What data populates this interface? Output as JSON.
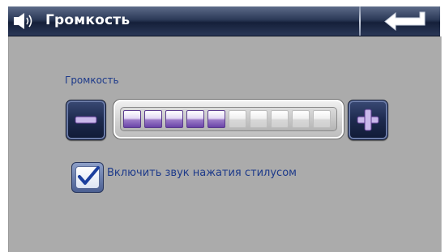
{
  "header": {
    "title": "Громкость",
    "speaker_icon": "speaker-icon",
    "back_icon": "return-arrow-icon"
  },
  "volume": {
    "label": "Громкость",
    "level": 5,
    "max": 10,
    "minus_icon": "minus-icon",
    "plus_icon": "plus-icon"
  },
  "stylus_sound": {
    "label": "Включить звук нажатия стилусом",
    "checked": true,
    "check_icon": "checkmark-icon"
  },
  "colors": {
    "header": "#1f2b49",
    "panel": "#ababab",
    "label_text": "#1d3a8a",
    "segment_on": "#7a55b6",
    "segment_off": "#e4e4e4"
  }
}
